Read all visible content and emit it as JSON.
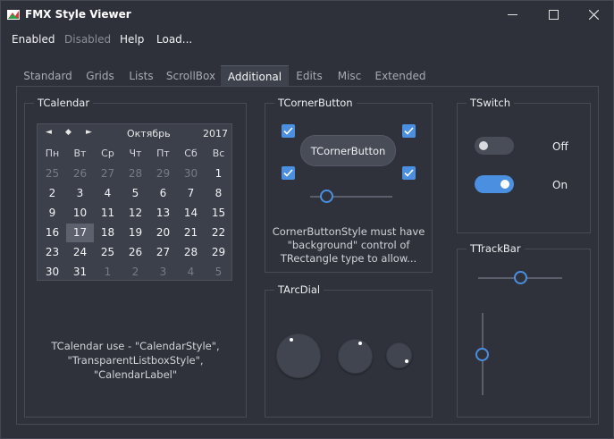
{
  "window": {
    "title": "FMX Style Viewer",
    "icons": {
      "app": "fmx-app-icon",
      "minimize": "minimize-icon",
      "maximize": "maximize-icon",
      "close": "close-icon"
    }
  },
  "menu": {
    "items": [
      {
        "label": "Enabled",
        "enabled": true
      },
      {
        "label": "Disabled",
        "enabled": false
      },
      {
        "label": "Help",
        "enabled": true
      },
      {
        "label": "Load...",
        "enabled": true
      }
    ]
  },
  "tabs": {
    "items": [
      "Standard",
      "Grids",
      "Lists",
      "ScrollBox",
      "Additional",
      "Edits",
      "Misc",
      "Extended"
    ],
    "active": "Additional"
  },
  "calendar_group": {
    "title": "TCalendar",
    "nav": {
      "prev": "◄",
      "today": "◆",
      "next": "►"
    },
    "month": "Октябрь",
    "year": "2017",
    "weekdays": [
      "Пн",
      "Вт",
      "Ср",
      "Чт",
      "Пт",
      "Сб",
      "Вс"
    ],
    "weeks": [
      [
        "25",
        "26",
        "27",
        "28",
        "29",
        "30",
        "1"
      ],
      [
        "2",
        "3",
        "4",
        "5",
        "6",
        "7",
        "8"
      ],
      [
        "9",
        "10",
        "11",
        "12",
        "13",
        "14",
        "15"
      ],
      [
        "16",
        "17",
        "18",
        "19",
        "20",
        "21",
        "22"
      ],
      [
        "23",
        "24",
        "25",
        "26",
        "27",
        "28",
        "29"
      ],
      [
        "30",
        "31",
        "1",
        "2",
        "3",
        "4",
        "5"
      ]
    ],
    "selected_day": "17",
    "note_line1": "TCalendar use - \"CalendarStyle\",",
    "note_line2": "\"TransparentListboxStyle\", \"CalendarLabel\""
  },
  "corner_group": {
    "title": "TCornerButton",
    "button_label": "TCornerButton",
    "checkboxes_checked": [
      true,
      true,
      true,
      true
    ],
    "trackbar_value_fraction": 0.2,
    "note_line1": "CornerButtonStyle must have",
    "note_line2": "\"background\" control of",
    "note_line3": "TRectangle type to allow..."
  },
  "switch_group": {
    "title": "TSwitch",
    "off_label": "Off",
    "on_label": "On",
    "switch1_on": false,
    "switch2_on": true
  },
  "arcdial_group": {
    "title": "TArcDial"
  },
  "trackbar_group": {
    "title": "TTrackBar",
    "horizontal_value_fraction": 0.5,
    "vertical_value_fraction": 0.5
  },
  "colors": {
    "accent": "#4a8fe0",
    "background": "#2e313a",
    "panel": "#3c404a",
    "text": "#e4e6ea",
    "disabled_text": "#8b8f98"
  }
}
